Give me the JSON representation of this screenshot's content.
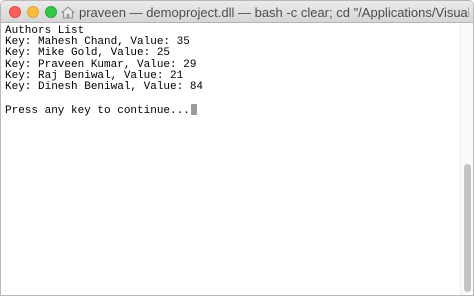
{
  "window": {
    "title": "praveen — demoproject.dll — bash -c clear; cd \"/Applications/Visual Studio.app/",
    "title_icon": "home-folder-icon"
  },
  "console": {
    "lines": [
      "Authors List",
      "Key: Mahesh Chand, Value: 35",
      "Key: Mike Gold, Value: 25",
      "Key: Praveen Kumar, Value: 29",
      "Key: Raj Beniwal, Value: 21",
      "Key: Dinesh Beniwal, Value: 84",
      "",
      "Press any key to continue..."
    ]
  },
  "colors": {
    "close": "#fc605c",
    "minimize": "#fdbc40",
    "maximize": "#34c84a"
  }
}
